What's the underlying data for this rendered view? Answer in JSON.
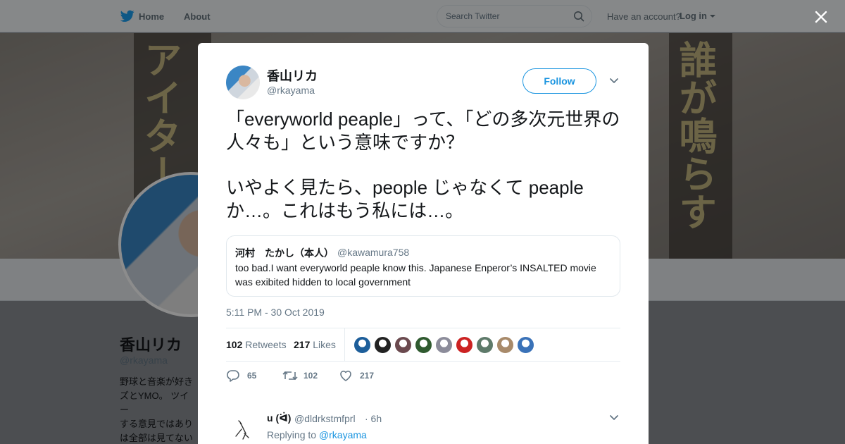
{
  "topbar": {
    "home_label": "Home",
    "about_label": "About",
    "search_placeholder": "Search Twitter",
    "have_account_text": "Have an account?",
    "login_label": "Log in"
  },
  "profile": {
    "name": "香山リカ",
    "handle": "@rkayama",
    "bio_partial": "野球と音楽が好き\nズとYMO。 ツイー\nする意見ではあり\nは全部は見てない\nす。相談には応じ"
  },
  "banner": {
    "left_text": "アイターズ",
    "right_text": "誰が鳴らす"
  },
  "tweet": {
    "author_name": "香山リカ",
    "author_handle": "@rkayama",
    "follow_label": "Follow",
    "text_line1": "「everyworld peaple」って、「どの多次元世界の人々も」という意味ですか？",
    "text_line2": "いやよく見たら、people じゃなくて peaple か…。これはもう私には…。",
    "quoted": {
      "author_name": "河村　たかし（本人）",
      "author_handle": "@kawamura758",
      "text": "too bad.I want everyworld peaple know this. Japanese Enperor’s INSALTED movie was exibited hidden to local government"
    },
    "timestamp": "5:11 PM - 30 Oct 2019",
    "retweets_count": "102",
    "retweets_label": "Retweets",
    "likes_count": "217",
    "likes_label": "Likes",
    "liker_colors": [
      "#1d5e9a",
      "#222222",
      "#6b4a4f",
      "#2f5a2f",
      "#8c8c9a",
      "#cc2222",
      "#5e7a6a",
      "#a88a6a",
      "#3a72b8"
    ],
    "actions": {
      "reply_count": "65",
      "retweet_count": "102",
      "like_count": "217"
    }
  },
  "reply": {
    "author_name": "u (ᐛ)",
    "author_handle": "@dldrkstmfprl",
    "time": "· 6h",
    "replying_prefix": "Replying to",
    "replying_to": "@rkayama"
  },
  "colors": {
    "accent": "#1b95e0",
    "secondary_text": "#657786",
    "border": "#e6ecf0"
  }
}
